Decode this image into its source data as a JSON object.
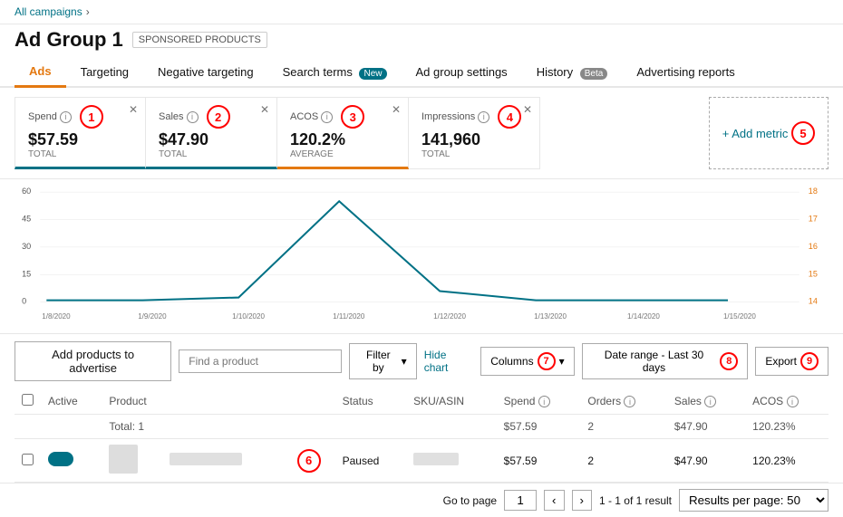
{
  "breadcrumb": {
    "link": "All campaigns",
    "chevron": "›"
  },
  "page": {
    "title": "Ad Group 1",
    "sponsored_badge": "SPONSORED PRODUCTS"
  },
  "tabs": [
    {
      "id": "ads",
      "label": "Ads",
      "active": true
    },
    {
      "id": "targeting",
      "label": "Targeting",
      "active": false
    },
    {
      "id": "negative-targeting",
      "label": "Negative targeting",
      "active": false,
      "badge": null
    },
    {
      "id": "search-terms",
      "label": "Search terms",
      "active": false,
      "badge": "New"
    },
    {
      "id": "ad-group-settings",
      "label": "Ad group settings",
      "active": false
    },
    {
      "id": "history",
      "label": "History",
      "active": false,
      "badge": "Beta"
    },
    {
      "id": "advertising-reports",
      "label": "Advertising reports",
      "active": false
    }
  ],
  "metrics": [
    {
      "id": "spend",
      "label": "Spend",
      "value": "$57.59",
      "sub": "TOTAL",
      "active_color": "blue",
      "circle_num": "1"
    },
    {
      "id": "sales",
      "label": "Sales",
      "value": "$47.90",
      "sub": "TOTAL",
      "active_color": "blue",
      "circle_num": "2"
    },
    {
      "id": "acos",
      "label": "ACOS",
      "value": "120.2%",
      "sub": "AVERAGE",
      "active_color": "orange",
      "circle_num": "3"
    },
    {
      "id": "impressions",
      "label": "Impressions",
      "value": "141,960",
      "sub": "TOTAL",
      "active_color": null,
      "circle_num": "4"
    }
  ],
  "add_metric_label": "+ Add metric",
  "add_metric_circle": "5",
  "chart": {
    "x_labels": [
      "1/8/2020",
      "1/9/2020",
      "1/10/2020",
      "1/11/2020",
      "1/12/2020",
      "1/13/2020",
      "1/14/2020",
      "1/15/2020"
    ],
    "y_left_labels": [
      "60",
      "45",
      "30",
      "15",
      "0"
    ],
    "y_right_labels": [
      "18",
      "17",
      "16",
      "15",
      "14"
    ]
  },
  "toolbar": {
    "add_products_label": "Add products to advertise",
    "search_placeholder": "Find a product",
    "filter_label": "Filter by",
    "hide_chart_label": "Hide chart",
    "columns_label": "Columns",
    "date_range_label": "Date range - Last 30 days",
    "export_label": "Export",
    "columns_circle": "7",
    "date_range_circle": "8",
    "export_circle": "9"
  },
  "table": {
    "columns": [
      "",
      "Active",
      "Product",
      "",
      "",
      "",
      "",
      "Status",
      "SKU/ASIN",
      "Spend",
      "Orders",
      "Sales",
      "ACOS"
    ],
    "total_row": {
      "label": "Total: 1",
      "spend": "$57.59",
      "orders": "2",
      "sales": "$47.90",
      "acos": "120.23%"
    },
    "data_row": {
      "status": "Paused",
      "spend": "$57.59",
      "orders": "2",
      "sales": "$47.90",
      "acos": "120.23%",
      "circle_num": "6"
    }
  },
  "pagination": {
    "go_to_page_label": "Go to page",
    "page_num": "1",
    "result_count": "1 - 1 of 1 result",
    "results_per_page_label": "Results per page: 50"
  }
}
